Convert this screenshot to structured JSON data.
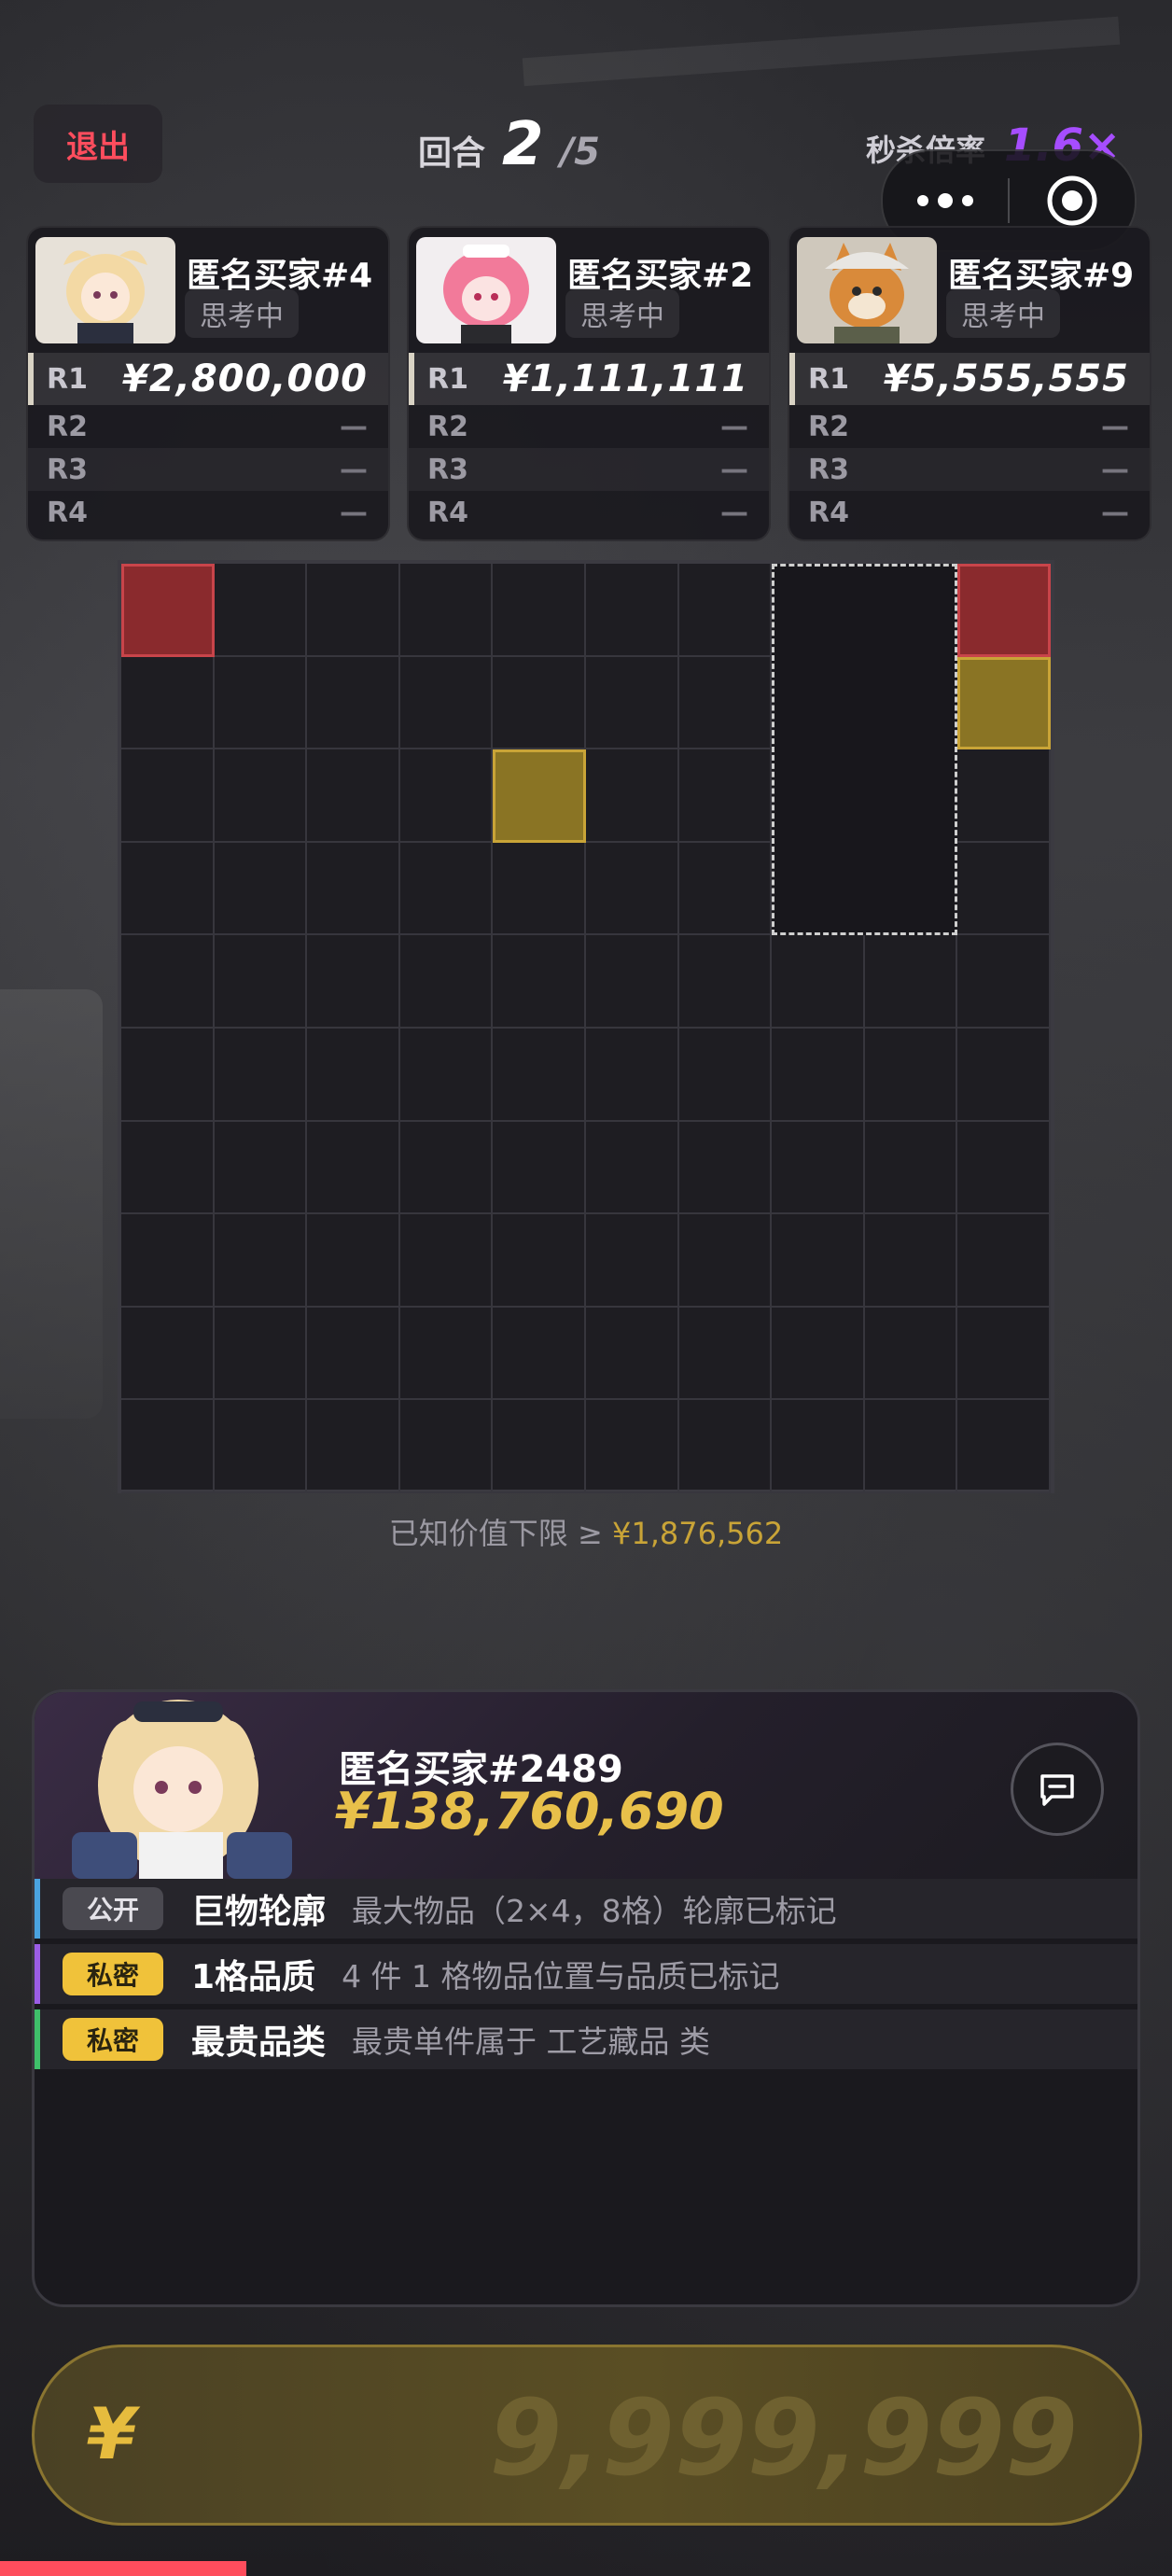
{
  "header": {
    "exit_label": "退出",
    "round_label": "回合",
    "round_current": "2",
    "round_total": "/5",
    "multiplier_label": "秒杀倍率",
    "multiplier_value": "1.6×"
  },
  "players": [
    {
      "name": "匿名买家#4",
      "status": "思考中",
      "rounds": [
        {
          "label": "R1",
          "value": "¥2,800,000"
        },
        {
          "label": "R2",
          "value": "—"
        },
        {
          "label": "R3",
          "value": "—"
        },
        {
          "label": "R4",
          "value": "—"
        }
      ]
    },
    {
      "name": "匿名买家#2",
      "status": "思考中",
      "rounds": [
        {
          "label": "R1",
          "value": "¥1,111,111"
        },
        {
          "label": "R2",
          "value": "—"
        },
        {
          "label": "R3",
          "value": "—"
        },
        {
          "label": "R4",
          "value": "—"
        }
      ]
    },
    {
      "name": "匿名买家#9",
      "status": "思考中",
      "rounds": [
        {
          "label": "R1",
          "value": "¥5,555,555"
        },
        {
          "label": "R2",
          "value": "—"
        },
        {
          "label": "R3",
          "value": "—"
        },
        {
          "label": "R4",
          "value": "—"
        }
      ]
    }
  ],
  "grid": {
    "cols": 10,
    "rows": 10,
    "marked_cells": [
      {
        "col": 0,
        "row": 0,
        "quality": "red"
      },
      {
        "col": 9,
        "row": 0,
        "quality": "red"
      },
      {
        "col": 9,
        "row": 1,
        "quality": "gold"
      },
      {
        "col": 4,
        "row": 2,
        "quality": "gold"
      }
    ],
    "outline": {
      "col": 7,
      "row": 0,
      "w": 2,
      "h": 4
    },
    "lower_bound_label": "已知价值下限 ≥",
    "lower_bound_value": "¥1,876,562"
  },
  "self": {
    "name": "匿名买家#2489",
    "money": "¥138,760,690"
  },
  "clues": [
    {
      "tag": "公开",
      "tag_type": "public",
      "title": "巨物轮廓",
      "desc": "最大物品（2×4，8格）轮廓已标记",
      "accent": "#4aa3e0"
    },
    {
      "tag": "私密",
      "tag_type": "private",
      "title": "1格品质",
      "desc": "4 件 1 格物品位置与品质已标记",
      "accent": "#9b5de5"
    },
    {
      "tag": "私密",
      "tag_type": "private",
      "title": "最贵品类",
      "desc": "最贵单件属于 工艺藏品 类",
      "accent": "#3fbf6a"
    }
  ],
  "bid": {
    "currency": "¥",
    "placeholder": "9,999,999"
  },
  "timer": {
    "remaining_fraction": 0.21
  },
  "colors": {
    "exit": "#ff4d5d",
    "multiplier": "#a64dff",
    "money": "#e8c04a",
    "red_quality": "#8a2a2d",
    "gold_quality": "#8a7424"
  },
  "icons": {
    "more": "more-dots-icon",
    "close": "target-close-icon",
    "chat": "chat-bubble-icon"
  }
}
